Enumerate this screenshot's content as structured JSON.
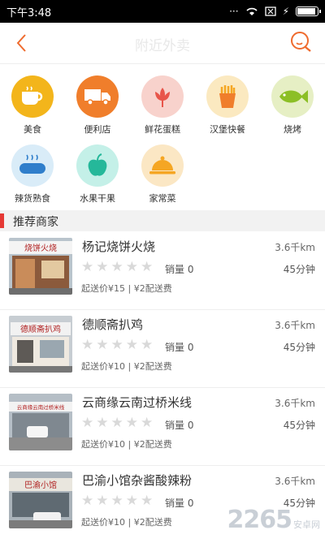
{
  "status": {
    "time": "下午3:48"
  },
  "header": {
    "title": "附近外卖"
  },
  "categories": [
    {
      "label": "美食",
      "icon": "coffee-cup-icon",
      "color": "#f3b51b"
    },
    {
      "label": "便利店",
      "icon": "delivery-truck-icon",
      "color": "#f07e2b"
    },
    {
      "label": "鲜花蛋糕",
      "icon": "lotus-flower-icon",
      "color": "#f8d2cc"
    },
    {
      "label": "汉堡快餐",
      "icon": "fries-icon",
      "color": "#fbe9c0"
    },
    {
      "label": "烧烤",
      "icon": "fish-icon",
      "color": "#e6efc4"
    },
    {
      "label": "辣货熟食",
      "icon": "sausage-icon",
      "color": "#d9ecf8"
    },
    {
      "label": "水果干果",
      "icon": "apple-icon",
      "color": "#c4f0e8"
    },
    {
      "label": "家常菜",
      "icon": "cloche-dish-icon",
      "color": "#fbe7c4"
    }
  ],
  "section": {
    "title": "推荐商家"
  },
  "shops": [
    {
      "name": "杨记烧饼火烧",
      "distance": "3.6千km",
      "sales": "销量 0",
      "time": "45分钟",
      "fee": "起送价¥15 | ¥2配送费",
      "sign": "烧饼火烧"
    },
    {
      "name": "德顺斋扒鸡",
      "distance": "3.6千km",
      "sales": "销量 0",
      "time": "45分钟",
      "fee": "起送价¥10 | ¥2配送费",
      "sign": "德顺斋扒鸡"
    },
    {
      "name": "云商缘云南过桥米线",
      "distance": "3.6千km",
      "sales": "销量 0",
      "time": "45分钟",
      "fee": "起送价¥10 | ¥2配送费",
      "sign": "云商缘云南过桥米线"
    },
    {
      "name": "巴渝小馆杂酱酸辣粉",
      "distance": "3.6千km",
      "sales": "销量 0",
      "time": "45分钟",
      "fee": "起送价¥10 | ¥2配送费",
      "sign": "巴渝小馆"
    }
  ],
  "watermark": {
    "big": "2265",
    "small": "安卓网"
  }
}
